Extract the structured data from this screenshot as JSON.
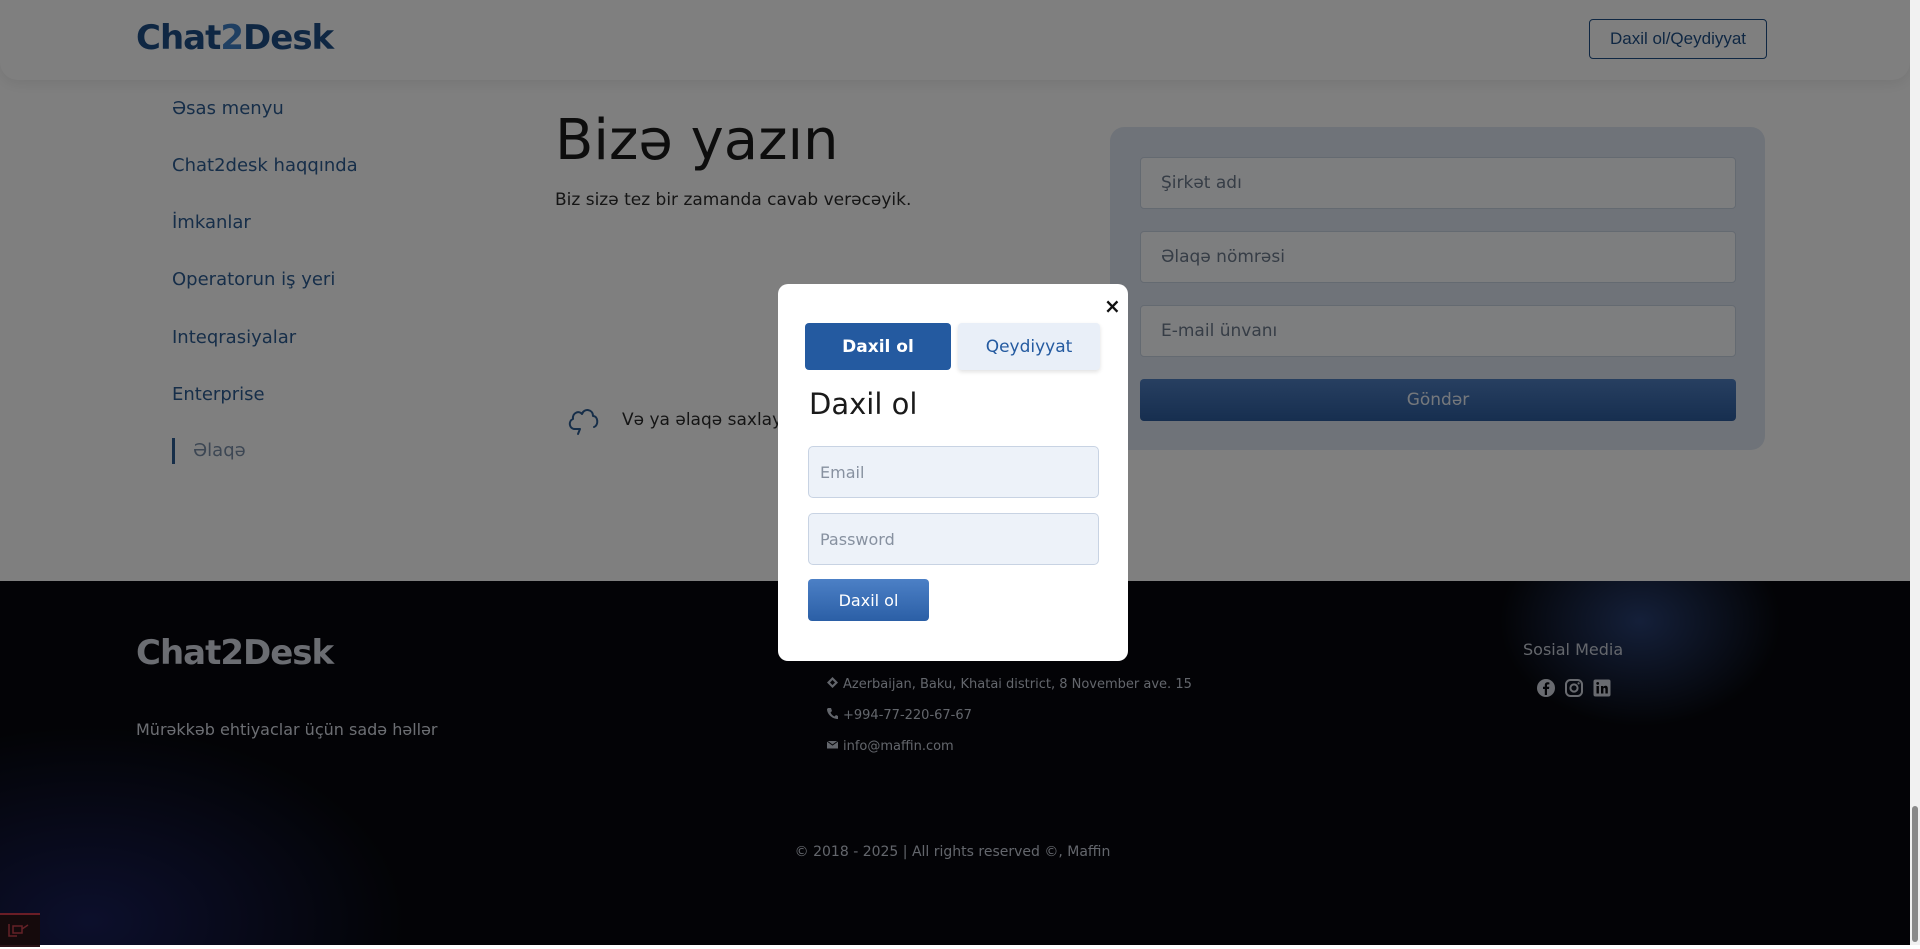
{
  "header": {
    "logo": {
      "part1": "Chat",
      "part2": "2",
      "part3": "Desk"
    },
    "auth_button": "Daxil ol/Qeydiyyat"
  },
  "sidebar": {
    "items": [
      {
        "label": "Əsas menyu",
        "active": false
      },
      {
        "label": "Chat2desk haqqında",
        "active": false
      },
      {
        "label": "İmkanlar",
        "active": false
      },
      {
        "label": "Operatorun iş yeri",
        "active": false
      },
      {
        "label": "Inteqrasiyalar",
        "active": false
      },
      {
        "label": "Enterprise",
        "active": false
      },
      {
        "label": "Əlaqə",
        "active": true
      }
    ]
  },
  "main": {
    "title": "Bizə yazın",
    "subtitle": "Biz sizə tez bir zamanda cavab verəcəyik.",
    "contact_text": "Və ya əlaqə saxlayın",
    "contact_icon": "cloud-icon"
  },
  "contact_form": {
    "company_placeholder": "Şirkət adı",
    "phone_placeholder": "Əlaqə nömrəsi",
    "email_placeholder": "E-mail ünvanı",
    "submit_label": "Göndər"
  },
  "footer": {
    "logo": "Chat2Desk",
    "tagline": "Mürəkkəb ehtiyaclar üçün sadə həllər",
    "address": "Azerbaijan, Baku, Khatai district, 8 November ave. 15",
    "phone": "+994-77-220-67-67",
    "email": "info@maffin.com",
    "social_title": "Sosial Media",
    "social_icons": [
      "facebook-icon",
      "instagram-icon",
      "linkedin-icon"
    ],
    "copyright": "© 2018 - 2025 | All rights reserved ©, Maffin"
  },
  "modal": {
    "close_symbol": "×",
    "tabs": {
      "login": "Daxil ol",
      "register": "Qeydiyyat"
    },
    "active_tab": "login",
    "heading": "Daxil ol",
    "email_placeholder": "Email",
    "password_placeholder": "Password",
    "submit_label": "Daxil ol"
  },
  "colors": {
    "brand_primary": "#245aa0",
    "footer_bg": "#06070c",
    "overlay": "rgba(0,0,0,0.5)"
  }
}
